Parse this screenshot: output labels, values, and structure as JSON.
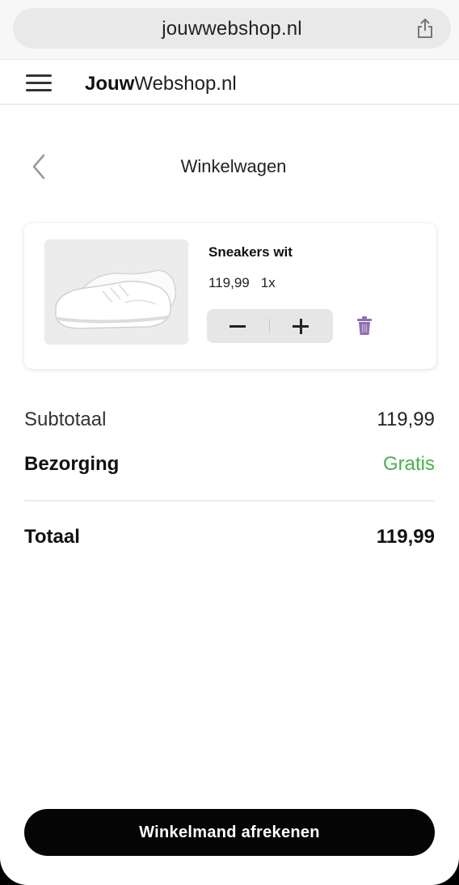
{
  "browser": {
    "url": "jouwwebshop.nl",
    "share_icon": "share-icon"
  },
  "header": {
    "logo_bold": "Jouw",
    "logo_light": "Webshop.nl",
    "menu_icon": "hamburger-menu-icon"
  },
  "page": {
    "title": "Winkelwagen",
    "back_icon": "chevron-left-icon"
  },
  "cart": {
    "items": [
      {
        "name": "Sneakers wit",
        "price": "119,99",
        "quantity": "1x",
        "image": "white-sneakers-image"
      }
    ]
  },
  "summary": {
    "subtotal_label": "Subtotaal",
    "subtotal_value": "119,99",
    "delivery_label": "Bezorging",
    "delivery_value": "Gratis",
    "total_label": "Totaal",
    "total_value": "119,99"
  },
  "checkout": {
    "label": "Winkelmand afrekenen"
  },
  "colors": {
    "accent_green": "#4caf50",
    "trash_purple": "#8e6fb4",
    "button_black": "#050505"
  }
}
